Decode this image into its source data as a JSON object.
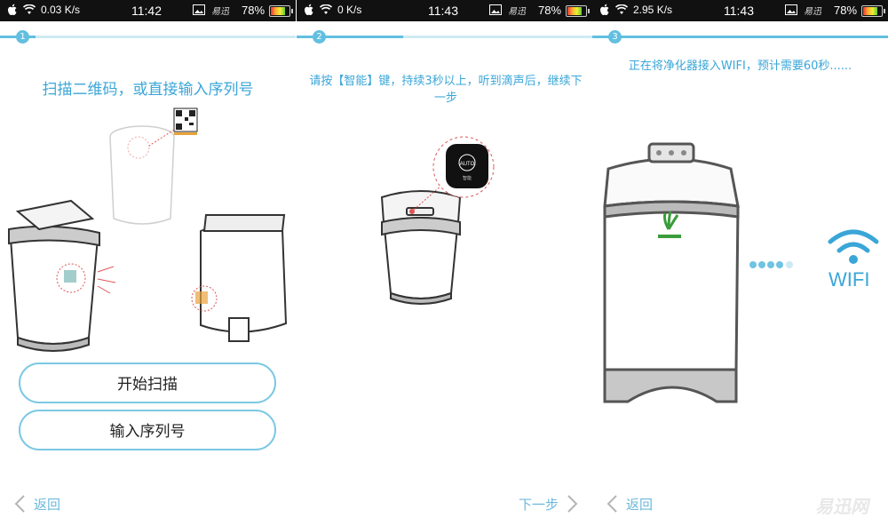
{
  "status_bars": [
    {
      "speed": "0.03 K/s",
      "time": "11:42",
      "battery": "78%",
      "carrier_logo": "易迅"
    },
    {
      "speed": "0 K/s",
      "time": "11:43",
      "battery": "78%",
      "carrier_logo": "易迅"
    },
    {
      "speed": "2.95 K/s",
      "time": "11:43",
      "battery": "78%",
      "carrier_logo": "易迅"
    }
  ],
  "battery_level": 0.78,
  "screens": [
    {
      "step_number": "1",
      "title": "扫描二维码，或直接输入序列号",
      "buttons": {
        "scan": "开始扫描",
        "serial": "输入序列号"
      },
      "back_label": "返回"
    },
    {
      "step_number": "2",
      "title": "请按【智能】键，持续3秒以上，听到滴声后，继续下一步",
      "auto_label": "AUTO",
      "auto_sub": "智能",
      "next_label": "下一步"
    },
    {
      "step_number": "3",
      "title": "正在将净化器接入WIFI，预计需要60秒......",
      "wifi_label": "WIFI",
      "back_label": "返回"
    }
  ],
  "watermark": "易迅网",
  "colors": {
    "accent": "#3aa6d8",
    "button_border": "#7cc8e4",
    "status_bar": "#111111"
  },
  "icons": {
    "back": "chevron-left-icon",
    "next": "chevron-right-icon",
    "wifi": "wifi-icon"
  }
}
